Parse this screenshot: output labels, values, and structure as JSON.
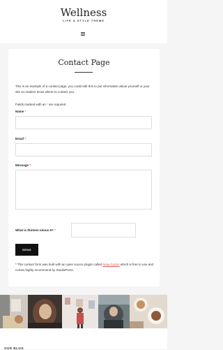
{
  "header": {
    "site_title": "Wellness",
    "tagline": "LIFE & STYLE THEME",
    "menu_icon": "hamburger-menu-icon"
  },
  "page": {
    "title": "Contact Page",
    "intro": "This is an example of a contact page, you could edit this to put information about yourself or your site so readers know where to contact you.",
    "required_note_prefix": "Fields marked with an ",
    "required_note_star": "*",
    "required_note_suffix": " are required"
  },
  "form": {
    "name_label": "Name",
    "email_label": "Email",
    "message_label": "Message",
    "captcha_label": "What is thirteen minus 6?",
    "required_mark": "*",
    "submit_label": "SEND",
    "name_value": "",
    "email_value": "",
    "message_value": "",
    "captcha_value": ""
  },
  "footnote": {
    "prefix": "* This contact form was built with an open source plugin called ",
    "link_text": "Ninja Forms",
    "suffix": " which is free to use and comes highly recommend by StudioPress."
  },
  "gallery": {
    "photos": [
      "photo-1",
      "photo-2",
      "photo-3",
      "photo-4",
      "photo-5",
      "photo-6"
    ]
  },
  "bottom": {
    "section_label": "OUR BLOG"
  },
  "colors": {
    "accent": "#e8564b",
    "button_bg": "#111111",
    "page_bg": "#f5f5f5"
  }
}
